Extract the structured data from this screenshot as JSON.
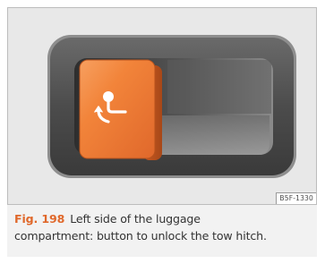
{
  "figure": {
    "image_code": "B5F-1330",
    "label": "Fig. 198",
    "caption_line1": "Left side of the luggage",
    "caption_line2": "compartment: button to unlock the tow hitch.",
    "icon": "tow-hitch-unlock-icon",
    "colors": {
      "accent": "#e0682b",
      "button_orange": "#f07a2e",
      "panel_gray": "#e8e8e8",
      "bezel_dark": "#4a4a4a"
    }
  }
}
